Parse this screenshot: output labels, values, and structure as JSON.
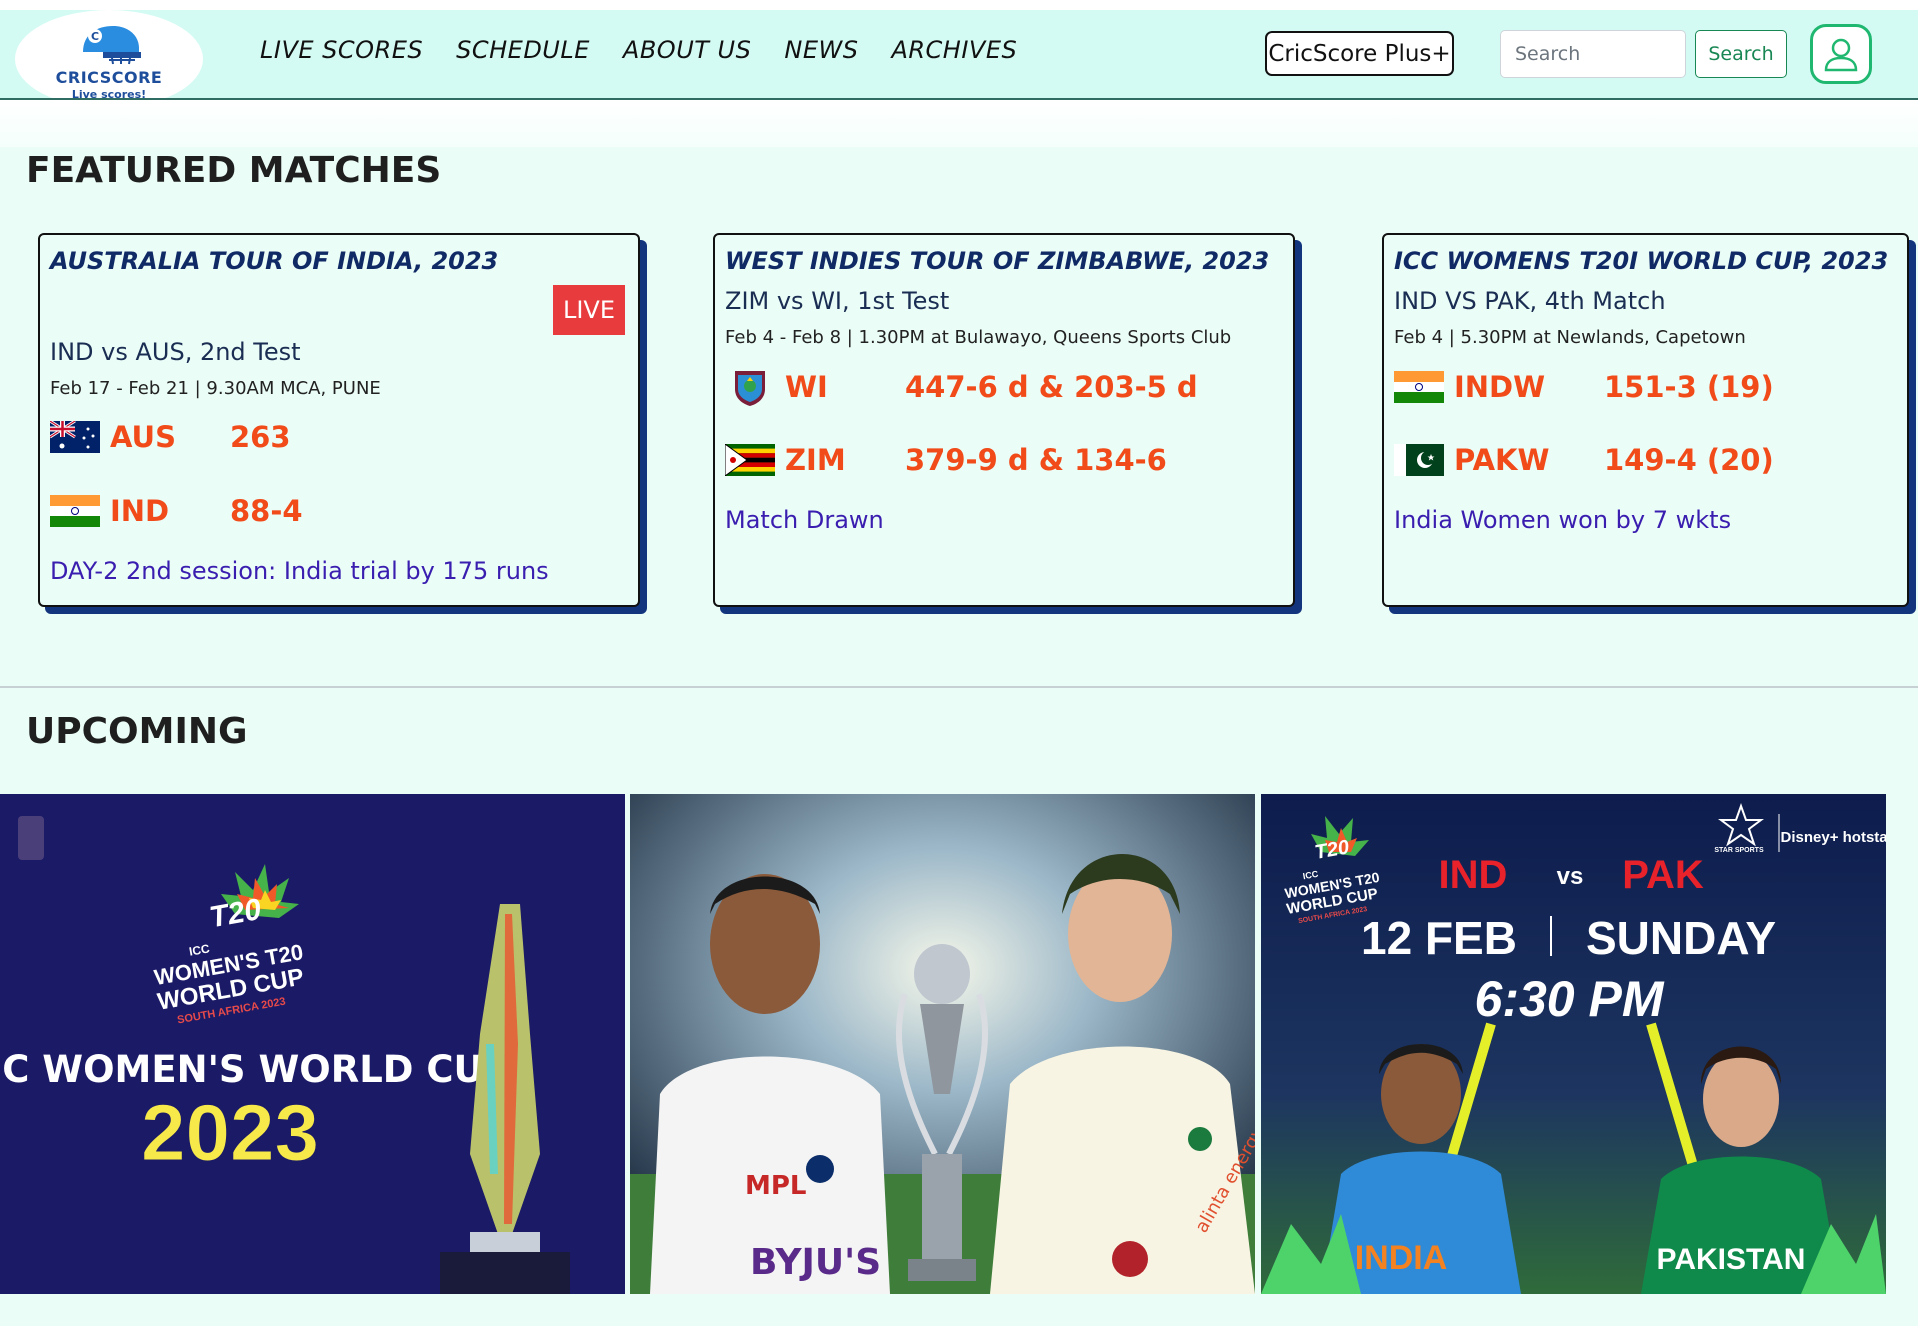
{
  "brand": {
    "name": "CRICSCORE",
    "tagline": "Live scores!"
  },
  "nav": {
    "links": [
      "LIVE SCORES",
      "SCHEDULE",
      "ABOUT US",
      "NEWS",
      "ARCHIVES"
    ],
    "plus_label": "CricScore Plus+",
    "search_placeholder": "Search",
    "search_button": "Search"
  },
  "featured": {
    "title": "FEATURED MATCHES",
    "cards": [
      {
        "series": "AUSTRALIA TOUR OF INDIA, 2023",
        "badge": "LIVE",
        "match": "IND vs AUS, 2nd Test",
        "meta": "Feb 17 - Feb 21 | 9.30AM MCA, PUNE",
        "teams": [
          {
            "flag": "australia-flag-icon",
            "name": "AUS",
            "score": "263"
          },
          {
            "flag": "india-flag-icon",
            "name": "IND",
            "score": "88-4"
          }
        ],
        "result": "DAY-2 2nd session: India trial by 175 runs"
      },
      {
        "series": "WEST INDIES TOUR OF ZIMBABWE, 2023",
        "match": "ZIM vs WI, 1st Test",
        "meta": "Feb 4 - Feb 8 | 1.30PM at Bulawayo, Queens Sports Club",
        "teams": [
          {
            "flag": "west-indies-crest-icon",
            "name": "WI",
            "score": "447-6 d & 203-5 d"
          },
          {
            "flag": "zimbabwe-flag-icon",
            "name": "ZIM",
            "score": "379-9 d & 134-6"
          }
        ],
        "result": "Match Drawn"
      },
      {
        "series": "ICC WOMENS T20I WORLD CUP, 2023",
        "match": "IND VS PAK, 4th Match",
        "meta": "Feb 4 | 5.30PM at Newlands, Capetown",
        "teams": [
          {
            "flag": "india-flag-icon",
            "name": "INDW",
            "score": "151-3 (19)"
          },
          {
            "flag": "pakistan-flag-icon",
            "name": "PAKW",
            "score": "149-4 (20)"
          }
        ],
        "result": "India Women won by 7 wkts"
      }
    ]
  },
  "upcoming": {
    "title": "UPCOMING",
    "banners": [
      {
        "logo_text": [
          "T20",
          "ICC",
          "WOMEN'S T20",
          "WORLD CUP",
          "SOUTH AFRICA 2023"
        ],
        "headline": "ICC WOMEN'S WORLD CUP",
        "year": "2023"
      },
      {
        "jersey_texts": [
          "MPL",
          "BYJU'S",
          "alinta energy"
        ]
      },
      {
        "logo_text": [
          "T20",
          "ICC",
          "WOMEN'S T20",
          "WORLD CUP",
          "SOUTH AFRICA 2023"
        ],
        "broadcasters": [
          "STAR SPORTS",
          "Disney+ hotstar"
        ],
        "team_a": "IND",
        "vs": "vs",
        "team_b": "PAK",
        "date": "12 FEB",
        "day": "SUNDAY",
        "time": "6:30 PM",
        "jersey_a": "INDIA",
        "jersey_b": "PAKISTAN"
      }
    ]
  },
  "colors": {
    "page_bg": "#ebfdf7",
    "nav_bg": "#d4fbf3",
    "score": "#f14b1a",
    "result": "#3a1eb0",
    "card_shadow": "#13357e",
    "live": "#e73b3d",
    "search_green": "#198754"
  }
}
